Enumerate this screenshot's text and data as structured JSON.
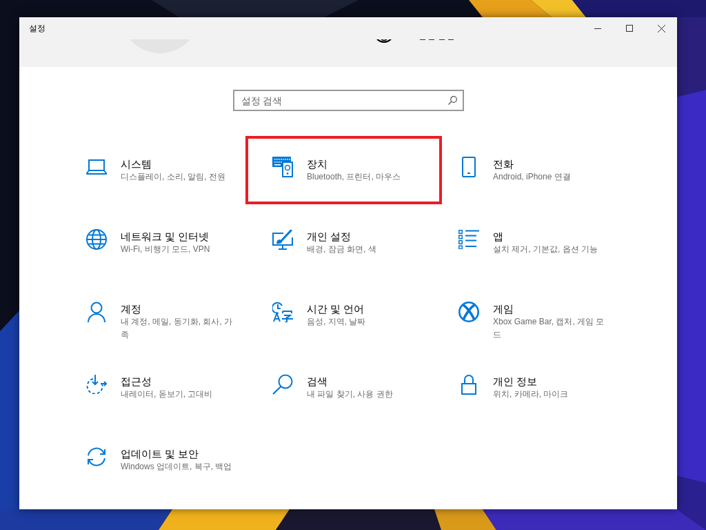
{
  "window": {
    "title": "설정"
  },
  "search": {
    "placeholder": "설정 검색"
  },
  "categories": [
    {
      "kind": "laptop",
      "title": "시스템",
      "description": "디스플레이, 소리, 알림, 전원",
      "highlighted": false
    },
    {
      "kind": "devices",
      "title": "장치",
      "description": "Bluetooth, 프린터, 마우스",
      "highlighted": true
    },
    {
      "kind": "phone",
      "title": "전화",
      "description": "Android, iPhone 연결",
      "highlighted": false
    },
    {
      "kind": "globe",
      "title": "네트워크 및 인터넷",
      "description": "Wi-Fi, 비행기 모드, VPN",
      "highlighted": false
    },
    {
      "kind": "personalization",
      "title": "개인 설정",
      "description": "배경, 잠금 화면, 색",
      "highlighted": false
    },
    {
      "kind": "apps",
      "title": "앱",
      "description": "설치 제거, 기본값, 옵션 기능",
      "highlighted": false
    },
    {
      "kind": "account",
      "title": "계정",
      "description": "내 계정, 메일, 동기화, 회사, 가족",
      "highlighted": false
    },
    {
      "kind": "time",
      "title": "시간 및 언어",
      "description": "음성, 지역, 날짜",
      "highlighted": false
    },
    {
      "kind": "game",
      "title": "게임",
      "description": "Xbox Game Bar, 캡처, 게임 모드",
      "highlighted": false
    },
    {
      "kind": "accessibility",
      "title": "접근성",
      "description": "내레이터, 돋보기, 고대비",
      "highlighted": false
    },
    {
      "kind": "search",
      "title": "검색",
      "description": "내 파일 찾기, 사용 권한",
      "highlighted": false
    },
    {
      "kind": "privacy",
      "title": "개인 정보",
      "description": "위치, 카메라, 마이크",
      "highlighted": false
    },
    {
      "kind": "update",
      "title": "업데이트 및 보안",
      "description": "Windows 업데이트, 복구, 백업",
      "highlighted": false
    }
  ]
}
